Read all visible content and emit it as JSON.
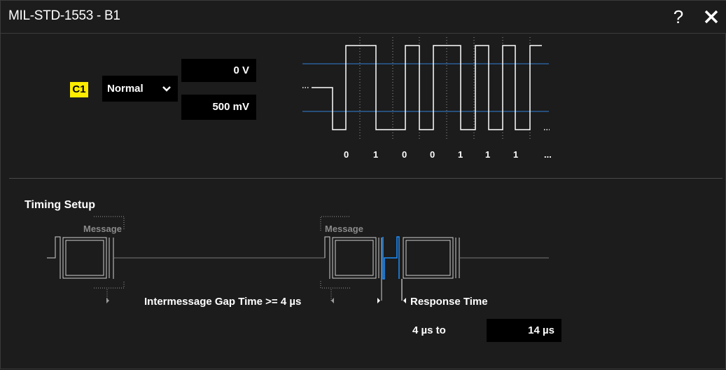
{
  "window": {
    "title": "MIL-STD-1553 - B1",
    "help_label": "?",
    "help_icon": "question-icon",
    "close_icon": "close-icon"
  },
  "source": {
    "channel_badge": "C1",
    "mode": "Normal",
    "high_threshold": "0 V",
    "low_threshold": "500 mV"
  },
  "bit_diagram": {
    "bits": [
      "0",
      "1",
      "0",
      "0",
      "1",
      "1",
      "1",
      "..."
    ]
  },
  "timing": {
    "section_title": "Timing Setup",
    "message_label_1": "Message",
    "message_label_2": "Message",
    "gap_label": "Intermessage Gap Time >= 4 µs",
    "response_label": "Response Time",
    "response_min": "4 µs to",
    "response_max": "14 µs"
  },
  "colors": {
    "badge": "#ffec00",
    "threshold_line": "#2f7fd6",
    "response_signal": "#1e90ff",
    "message_label": "#8a8a8a"
  }
}
